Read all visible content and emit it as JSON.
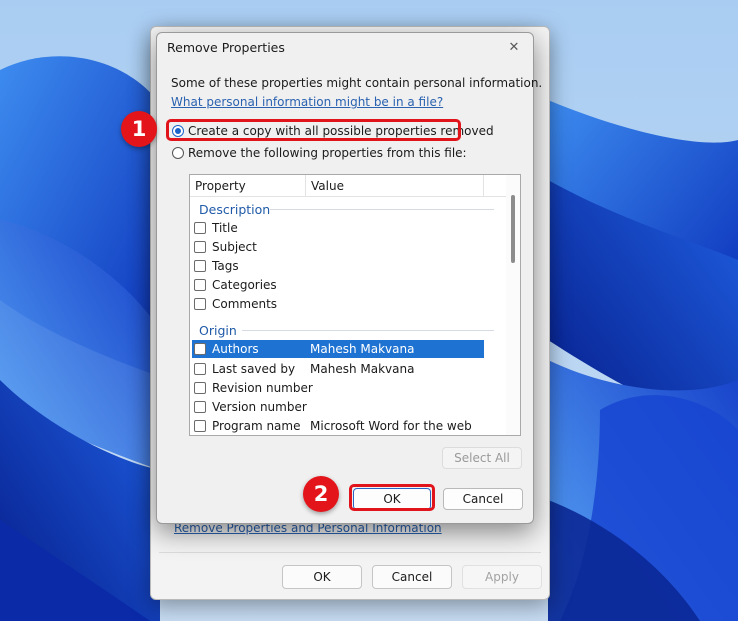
{
  "background_dialog": {
    "link": "Remove Properties and Personal Information",
    "ok_label": "OK",
    "cancel_label": "Cancel",
    "apply_label": "Apply"
  },
  "dialog": {
    "title": "Remove Properties",
    "close_glyph": "✕",
    "info_text": "Some of these properties might contain personal information.",
    "info_link": "What personal information might be in a file?",
    "option_copy": "Create a copy with all possible properties removed",
    "option_remove": "Remove the following properties from this file:",
    "selected_option": "copy",
    "list": {
      "header_property": "Property",
      "header_value": "Value",
      "groups": [
        {
          "name": "Description",
          "rows": [
            {
              "name": "Title",
              "value": ""
            },
            {
              "name": "Subject",
              "value": ""
            },
            {
              "name": "Tags",
              "value": ""
            },
            {
              "name": "Categories",
              "value": ""
            },
            {
              "name": "Comments",
              "value": ""
            }
          ]
        },
        {
          "name": "Origin",
          "rows": [
            {
              "name": "Authors",
              "value": "Mahesh Makvana",
              "selected": true
            },
            {
              "name": "Last saved by",
              "value": "Mahesh Makvana"
            },
            {
              "name": "Revision number",
              "value": ""
            },
            {
              "name": "Version number",
              "value": ""
            },
            {
              "name": "Program name",
              "value": "Microsoft Word for the web"
            }
          ]
        }
      ]
    },
    "select_all_label": "Select All",
    "ok_label": "OK",
    "cancel_label": "Cancel"
  },
  "annotations": {
    "step1": "1",
    "step2": "2",
    "highlight_color": "#e1141c"
  },
  "colors": {
    "selection": "#1e73d2",
    "link": "#2a62b0",
    "group_heading": "#1f5aa8"
  }
}
